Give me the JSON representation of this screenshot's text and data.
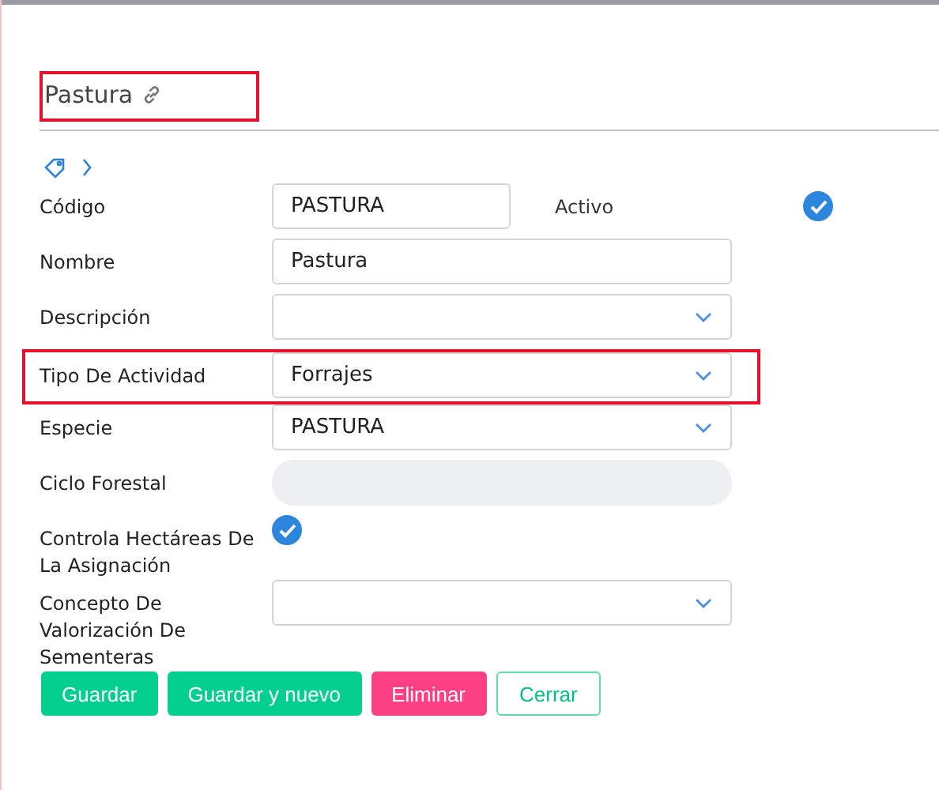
{
  "title": "Pastura",
  "fields": [
    {
      "label": "Código",
      "kind": "text",
      "value": "PASTURA",
      "side": {
        "label": "Activo",
        "checked": true
      }
    },
    {
      "label": "Nombre",
      "kind": "text",
      "value": "Pastura"
    },
    {
      "label": "Descripción",
      "kind": "select"
    },
    {
      "label": "Tipo De Actividad",
      "kind": "select",
      "value": "Forrajes",
      "highlighted": true
    },
    {
      "label": "Especie",
      "kind": "select",
      "value": "PASTURA"
    },
    {
      "label": "Ciclo Forestal",
      "kind": "disabled"
    },
    {
      "label": "Controla Hectáreas De La Asignación",
      "kind": "checkbox",
      "checked": true
    },
    {
      "label": "Concepto De Valorización De Sementeras",
      "kind": "select"
    }
  ],
  "buttons": [
    {
      "label": "Guardar",
      "kind": "primary"
    },
    {
      "label": "Guardar y nuevo",
      "kind": "primary"
    },
    {
      "label": "Eliminar",
      "kind": "danger"
    },
    {
      "label": "Cerrar",
      "kind": "outline"
    }
  ]
}
